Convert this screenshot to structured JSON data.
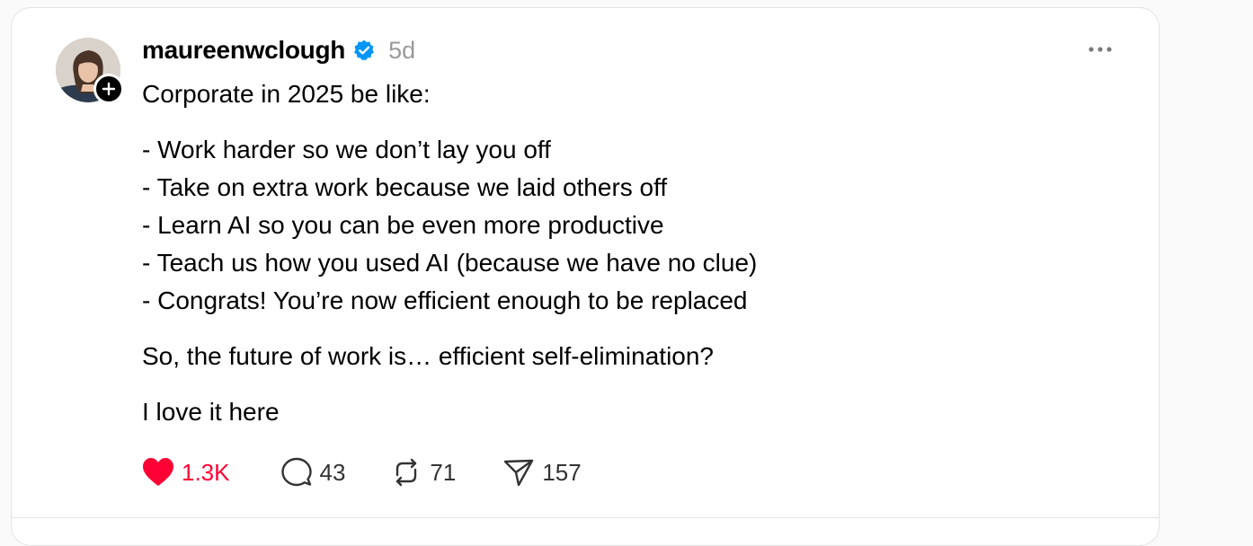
{
  "post": {
    "username": "maureenwclough",
    "timestamp": "5d",
    "body": {
      "intro": "Corporate in 2025 be like:",
      "list": [
        "- Work harder so we don’t lay you off",
        "- Take on extra work because we laid others off",
        "- Learn AI so you can be even more productive",
        "- Teach us how you used AI (because we have no clue)",
        "- Congrats! You’re now efficient enough to be replaced"
      ],
      "question": "So, the future of work is… efficient self-elimination?",
      "closing": "I love it here"
    },
    "actions": {
      "likes": "1.3K",
      "replies": "43",
      "reposts": "71",
      "shares": "157"
    }
  },
  "icons": {
    "verified": "verified-check-icon",
    "follow": "plus-icon",
    "more": "more-dots-icon",
    "like": "heart-filled-icon",
    "reply": "comment-bubble-icon",
    "repost": "repost-icon",
    "share": "send-icon"
  },
  "colors": {
    "like_active": "#ff0034",
    "verified": "#0095f6",
    "muted_text": "#9a9a9a"
  }
}
